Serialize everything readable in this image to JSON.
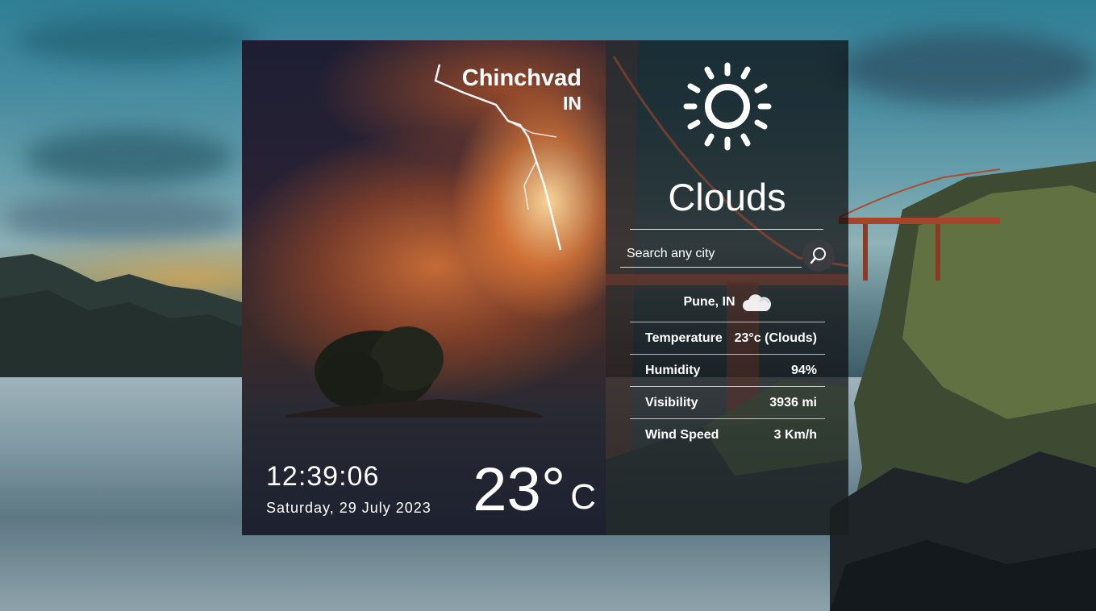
{
  "location": {
    "city": "Chinchvad",
    "country": "IN"
  },
  "clock": {
    "time": "12:39:06",
    "date": "Saturday, 29 July 2023"
  },
  "temperature": {
    "value": "23°",
    "unit": "C"
  },
  "weather": {
    "main": "Clouds",
    "icon": "sun-icon"
  },
  "search": {
    "placeholder": "Search any city"
  },
  "result": {
    "location": "Pune, IN",
    "icon": "cloud-icon",
    "stats": [
      {
        "label": "Temperature",
        "value": "23°c (Clouds)"
      },
      {
        "label": "Humidity",
        "value": "94%"
      },
      {
        "label": "Visibility",
        "value": "3936 mi"
      },
      {
        "label": "Wind Speed",
        "value": "3 Km/h"
      }
    ]
  },
  "colors": {
    "panel_dark": "#0c0c0e",
    "text": "#ffffff"
  }
}
